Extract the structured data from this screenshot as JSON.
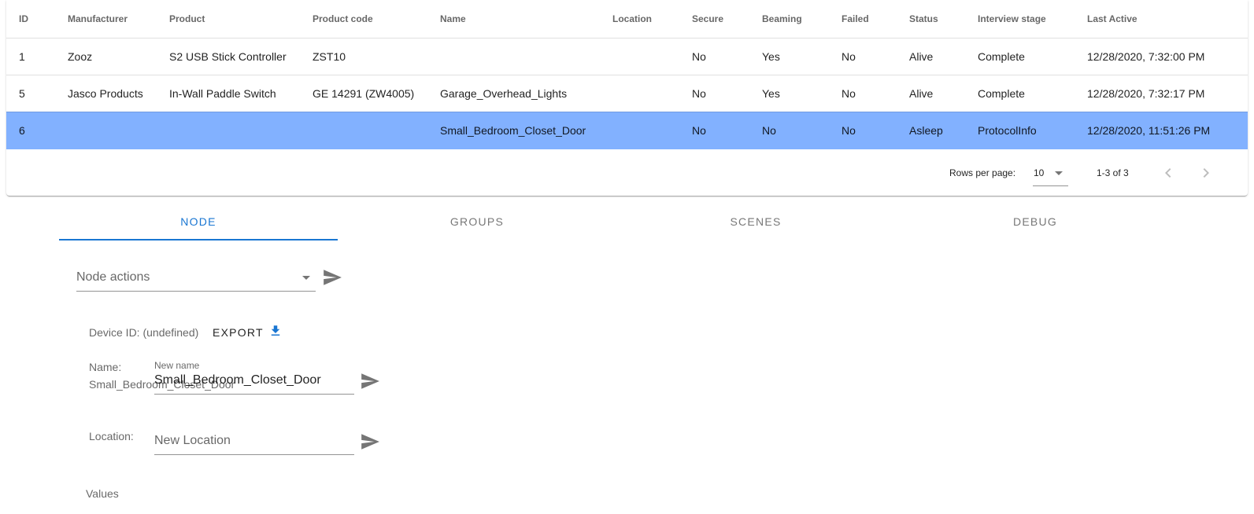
{
  "table": {
    "columns": [
      "ID",
      "Manufacturer",
      "Product",
      "Product code",
      "Name",
      "Location",
      "Secure",
      "Beaming",
      "Failed",
      "Status",
      "Interview stage",
      "Last Active"
    ],
    "rows": [
      [
        "1",
        "Zooz",
        "S2 USB Stick Controller",
        "ZST10",
        "",
        "",
        "No",
        "Yes",
        "No",
        "Alive",
        "Complete",
        "12/28/2020, 7:32:00 PM"
      ],
      [
        "5",
        "Jasco Products",
        "In-Wall Paddle Switch",
        "GE 14291 (ZW4005)",
        "Garage_Overhead_Lights",
        "",
        "No",
        "Yes",
        "No",
        "Alive",
        "Complete",
        "12/28/2020, 7:32:17 PM"
      ],
      [
        "6",
        "",
        "",
        "",
        "Small_Bedroom_Closet_Door",
        "",
        "No",
        "No",
        "No",
        "Asleep",
        "ProtocolInfo",
        "12/28/2020, 11:51:26 PM"
      ]
    ],
    "selected_row_color": "#82b1ff"
  },
  "pagination": {
    "rows_per_page_label": "Rows per page:",
    "rows_per_page_value": "10",
    "page_info": "1-3 of 3",
    "prev_icon": "chevron-left-icon",
    "next_icon": "chevron-right-icon"
  },
  "tabs": [
    {
      "label": "NODE",
      "active": true
    },
    {
      "label": "GROUPS",
      "active": false
    },
    {
      "label": "SCENES",
      "active": false
    },
    {
      "label": "DEBUG",
      "active": false
    }
  ],
  "accent_color": "#1976d2",
  "node": {
    "actions_label": "Node actions",
    "device_id_text": "Device ID: (undefined)",
    "export_label": "EXPORT",
    "export_icon": "download-icon",
    "send_icon": "send-icon",
    "name_label": "Name:",
    "name_current": "Small_Bedroom_Closet_Door",
    "new_name_label": "New name",
    "new_name_value": "Small_Bedroom_Closet_Door",
    "location_label": "Location:",
    "location_placeholder": "New Location",
    "values_label": "Values"
  }
}
